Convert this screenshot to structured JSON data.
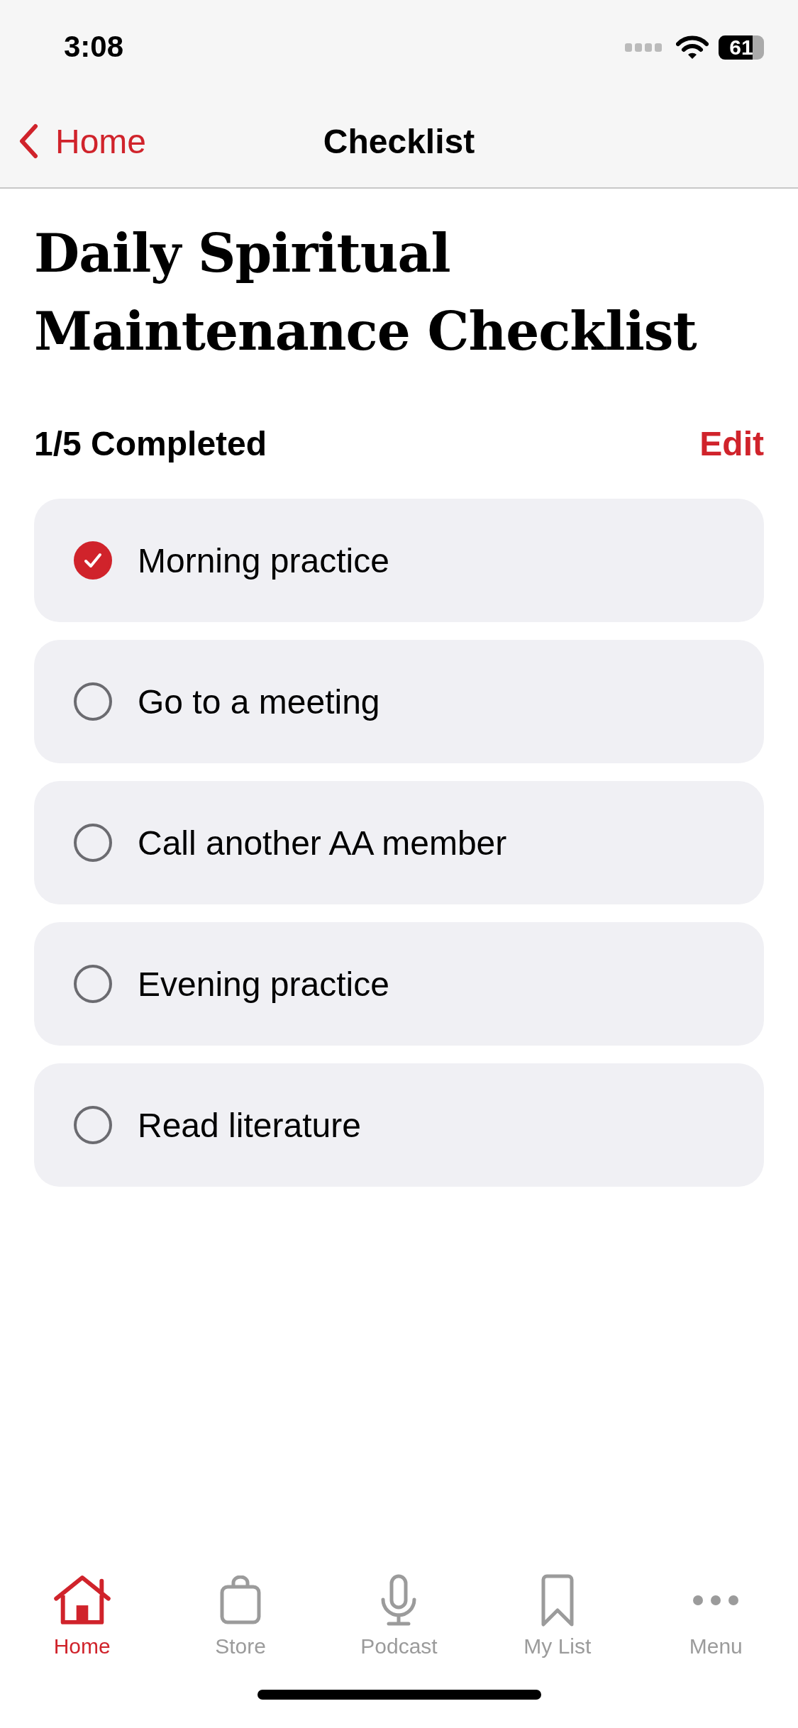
{
  "status_bar": {
    "time": "3:08",
    "battery": "61"
  },
  "nav_bar": {
    "back": "Home",
    "title": "Checklist"
  },
  "heading": "Daily Spiritual Maintenance Checklist",
  "progress": {
    "summary": "1/5 Completed",
    "edit": "Edit"
  },
  "items": [
    {
      "label": "Morning practice",
      "checked": true
    },
    {
      "label": "Go to a meeting",
      "checked": false
    },
    {
      "label": "Call another AA member",
      "checked": false
    },
    {
      "label": "Evening practice",
      "checked": false
    },
    {
      "label": "Read literature",
      "checked": false
    }
  ],
  "tabs": [
    {
      "label": "Home",
      "selected": true
    },
    {
      "label": "Store",
      "selected": false
    },
    {
      "label": "Podcast",
      "selected": false
    },
    {
      "label": "My List",
      "selected": false
    },
    {
      "label": "Menu",
      "selected": false
    }
  ]
}
